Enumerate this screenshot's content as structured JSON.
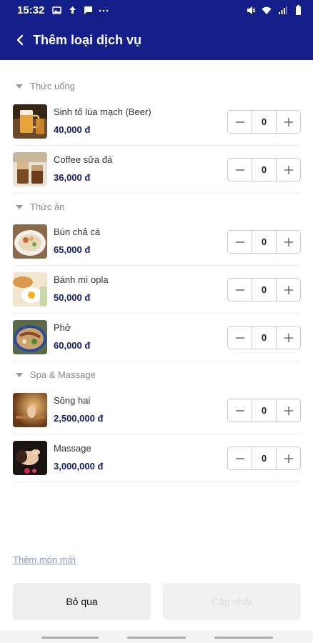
{
  "status_bar": {
    "time": "15:32",
    "left_icons": [
      "photo-icon",
      "upload-icon",
      "bell-icon",
      "message-icon",
      "more-icon"
    ],
    "right_icons": [
      "mute-icon",
      "wifi-icon",
      "signal-icon",
      "battery-icon"
    ]
  },
  "app_bar": {
    "title": "Thêm loại dịch vụ"
  },
  "categories": [
    {
      "label": "Thức uống",
      "items": [
        {
          "name": "Sinh tố lúa mạch (Beer)",
          "price": "40,000 đ",
          "qty": "0",
          "thumb": "beer-thumbnail"
        },
        {
          "name": "Coffee sữa đá",
          "price": "36,000 đ",
          "qty": "0",
          "thumb": "coffee-thumbnail"
        }
      ]
    },
    {
      "label": "Thức ăn",
      "items": [
        {
          "name": "Bún chả cá",
          "price": "65,000 đ",
          "qty": "0",
          "thumb": "noodle-thumbnail"
        },
        {
          "name": "Bánh mì opla",
          "price": "50,000 đ",
          "qty": "0",
          "thumb": "egg-bread-thumbnail"
        },
        {
          "name": "Phở",
          "price": "60,000 đ",
          "qty": "0",
          "thumb": "pho-thumbnail"
        }
      ]
    },
    {
      "label": "Spa & Massage",
      "items": [
        {
          "name": "Sông hai",
          "price": "2,500,000 đ",
          "qty": "0",
          "thumb": "sauna-thumbnail"
        },
        {
          "name": "Massage",
          "price": "3,000,000 đ",
          "qty": "0",
          "thumb": "massage-thumbnail"
        }
      ]
    }
  ],
  "add_new_link": "Thêm món mới",
  "buttons": {
    "skip": "Bỏ qua",
    "update": "Cập nhật"
  },
  "colors": {
    "primary": "#141f8a",
    "price": "#141f6a",
    "link": "#8a96c8"
  }
}
